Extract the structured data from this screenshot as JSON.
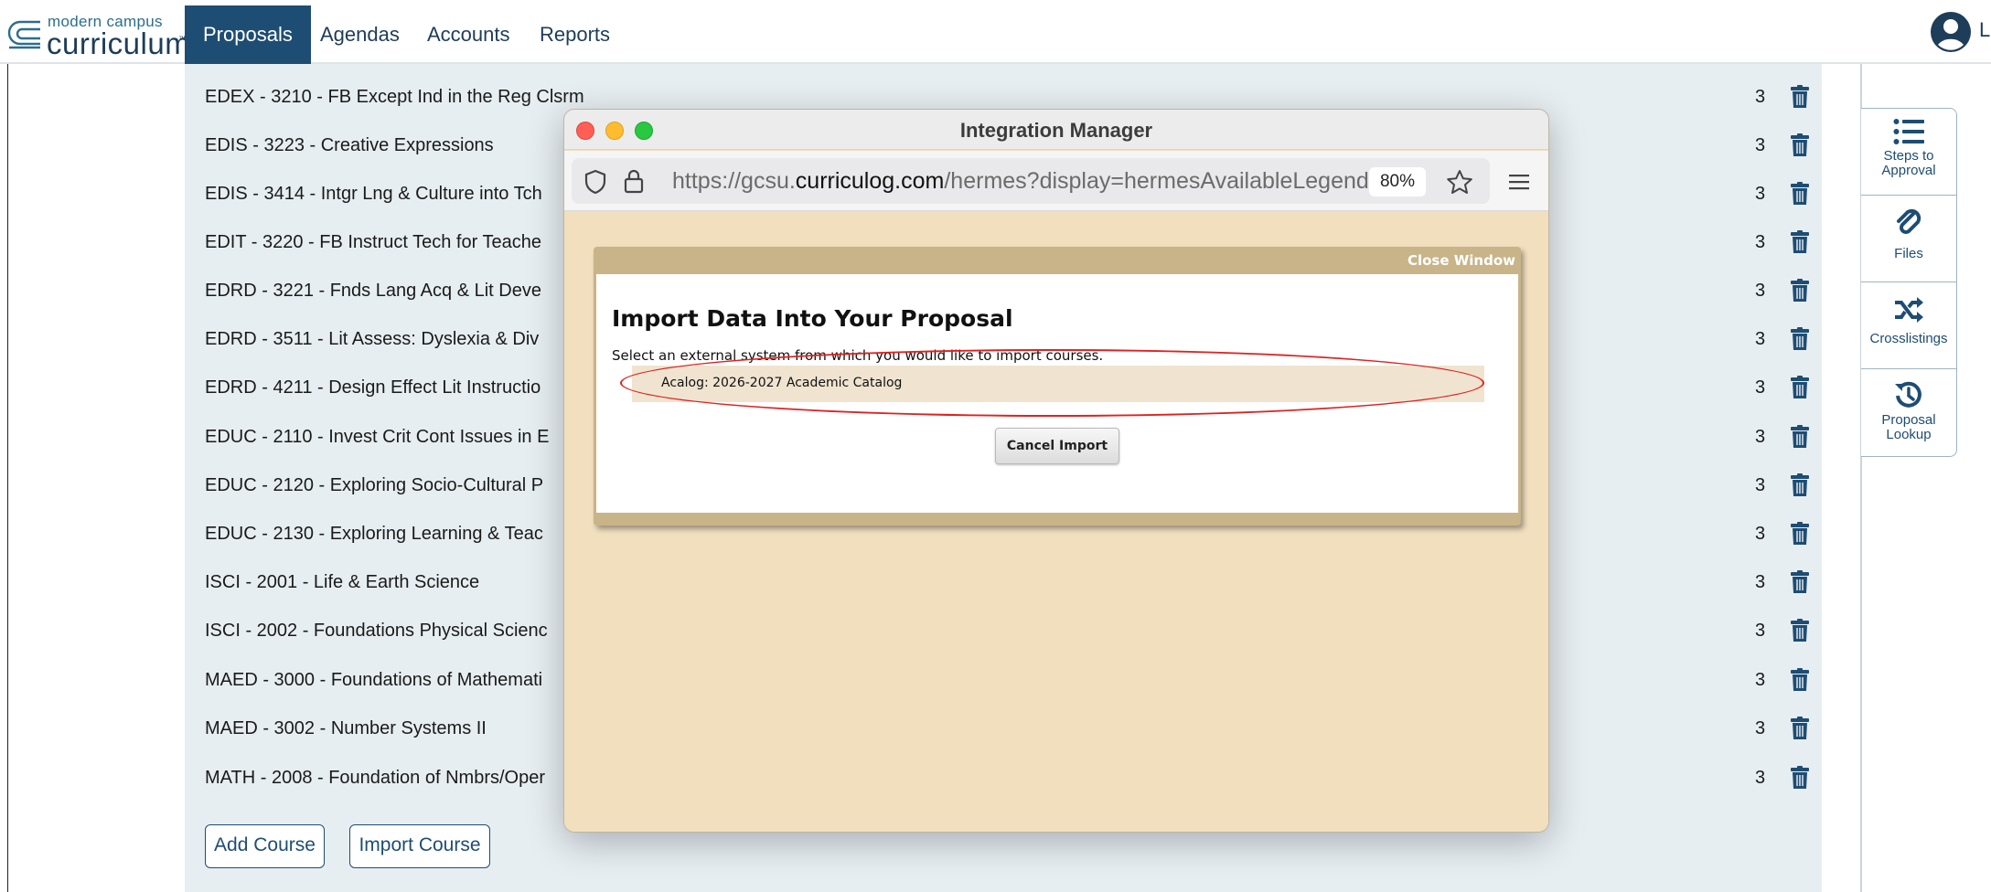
{
  "brand": {
    "line1": "modern campus",
    "line2": "curriculum",
    "tm": "™"
  },
  "nav": {
    "tabs": [
      {
        "label": "Proposals",
        "active": true
      },
      {
        "label": "Agendas",
        "active": false
      },
      {
        "label": "Accounts",
        "active": false
      },
      {
        "label": "Reports",
        "active": false
      }
    ],
    "user_initial": "L"
  },
  "courses": [
    {
      "name": "EDEX - 3210 - FB Except Ind in the Reg Clsrm",
      "credits": "3"
    },
    {
      "name": "EDIS - 3223 - Creative Expressions",
      "credits": "3"
    },
    {
      "name": "EDIS - 3414 - Intgr Lng & Culture into Tch",
      "credits": "3"
    },
    {
      "name": "EDIT - 3220 - FB Instruct Tech for Teache",
      "credits": "3"
    },
    {
      "name": "EDRD - 3221 - Fnds Lang Acq & Lit Deve",
      "credits": "3"
    },
    {
      "name": "EDRD - 3511 - Lit Assess: Dyslexia & Div",
      "credits": "3"
    },
    {
      "name": "EDRD - 4211 - Design Effect Lit Instructio",
      "credits": "3"
    },
    {
      "name": "EDUC - 2110 - Invest Crit Cont Issues in E",
      "credits": "3"
    },
    {
      "name": "EDUC - 2120 - Exploring Socio-Cultural P",
      "credits": "3"
    },
    {
      "name": "EDUC - 2130 - Exploring Learning & Teac",
      "credits": "3"
    },
    {
      "name": "ISCI - 2001 - Life & Earth Science",
      "credits": "3"
    },
    {
      "name": "ISCI - 2002 - Foundations Physical Scienc",
      "credits": "3"
    },
    {
      "name": "MAED - 3000 - Foundations of Mathemati",
      "credits": "3"
    },
    {
      "name": "MAED - 3002 - Number Systems II",
      "credits": "3"
    },
    {
      "name": "MATH - 2008 - Foundation of Nmbrs/Oper",
      "credits": "3"
    }
  ],
  "actions": {
    "add_course": "Add Course",
    "import_course": "Import Course"
  },
  "rail": {
    "items": [
      {
        "label_1": "Steps to",
        "label_2": "Approval",
        "icon": "list-icon"
      },
      {
        "label_1": "Files",
        "label_2": "",
        "icon": "paperclip-icon"
      },
      {
        "label_1": "Crosslistings",
        "label_2": "",
        "icon": "shuffle-icon"
      },
      {
        "label_1": "Proposal",
        "label_2": "Lookup",
        "icon": "history-icon"
      }
    ]
  },
  "popup": {
    "title": "Integration Manager",
    "url_prefix": "https://gcsu.",
    "url_host": "curriculog.com",
    "url_path": "/hermes?display=hermesAvailableLegend",
    "zoom": "80%",
    "dialog": {
      "close_label": "Close Window",
      "heading": "Import Data Into Your Proposal",
      "subtext": "Select an external system from which you would like to import courses.",
      "option": "Acalog: 2026-2027 Academic Catalog",
      "cancel_label": "Cancel Import"
    }
  },
  "colors": {
    "nav_active": "#1e4d73",
    "panel_bg": "#e7eef2",
    "popup_bg": "#f1dfbe",
    "dialog_frame": "#c8b488",
    "highlight_ring": "#e0211f"
  }
}
